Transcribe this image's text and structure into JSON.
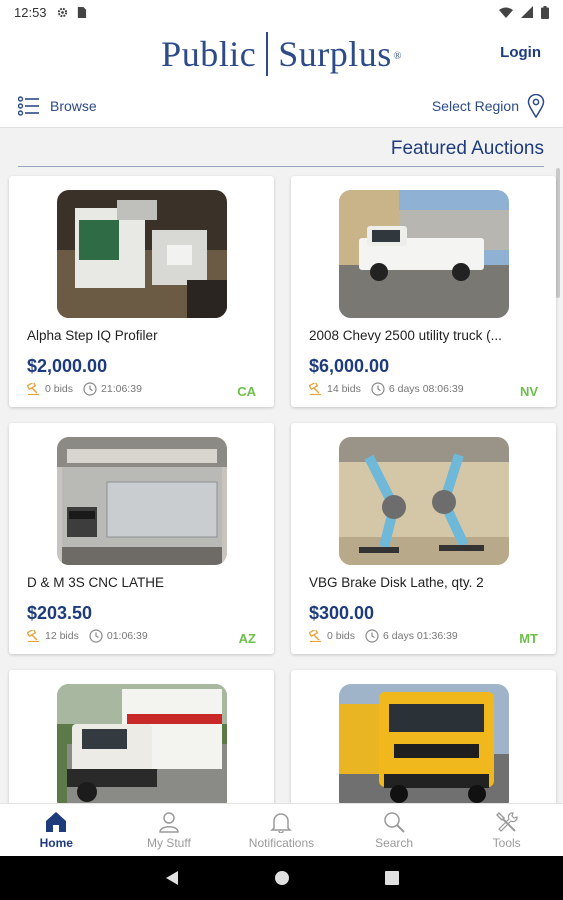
{
  "status_bar": {
    "time": "12:53",
    "icons_left": [
      "gear-icon",
      "sim-card-icon"
    ],
    "icons_right": [
      "wifi-icon",
      "signal-icon",
      "battery-icon"
    ]
  },
  "header": {
    "logo_left": "Public",
    "logo_right": "Surplus",
    "logo_reg": "®",
    "login_label": "Login"
  },
  "browse_bar": {
    "browse_label": "Browse",
    "region_label": "Select Region"
  },
  "section": {
    "title": "Featured Auctions"
  },
  "auctions": [
    {
      "title": "Alpha Step IQ Profiler",
      "price": "$2,000.00",
      "bids": "0 bids",
      "time_left": "21:06:39",
      "state": "CA"
    },
    {
      "title": "2008 Chevy 2500 utility truck   (...",
      "price": "$6,000.00",
      "bids": "14 bids",
      "time_left": "6 days 08:06:39",
      "state": "NV"
    },
    {
      "title": "D & M 3S CNC LATHE",
      "price": "$203.50",
      "bids": "12 bids",
      "time_left": "01:06:39",
      "state": "AZ"
    },
    {
      "title": "VBG Brake Disk Lathe,  qty. 2",
      "price": "$300.00",
      "bids": "0 bids",
      "time_left": "6 days 01:36:39",
      "state": "MT"
    },
    {
      "title": "",
      "price": "",
      "bids": "",
      "time_left": "",
      "state": ""
    },
    {
      "title": "",
      "price": "",
      "bids": "",
      "time_left": "",
      "state": ""
    }
  ],
  "bottom_nav": [
    {
      "label": "Home",
      "icon": "home-icon",
      "active": true
    },
    {
      "label": "My Stuff",
      "icon": "person-icon",
      "active": false
    },
    {
      "label": "Notifications",
      "icon": "bell-icon",
      "active": false
    },
    {
      "label": "Search",
      "icon": "search-icon",
      "active": false
    },
    {
      "label": "Tools",
      "icon": "tools-icon",
      "active": false
    }
  ],
  "colors": {
    "brand": "#1e3c7c",
    "logo": "#2d4a8a",
    "state": "#6cc04a",
    "bid_icon": "#e8a23a"
  }
}
